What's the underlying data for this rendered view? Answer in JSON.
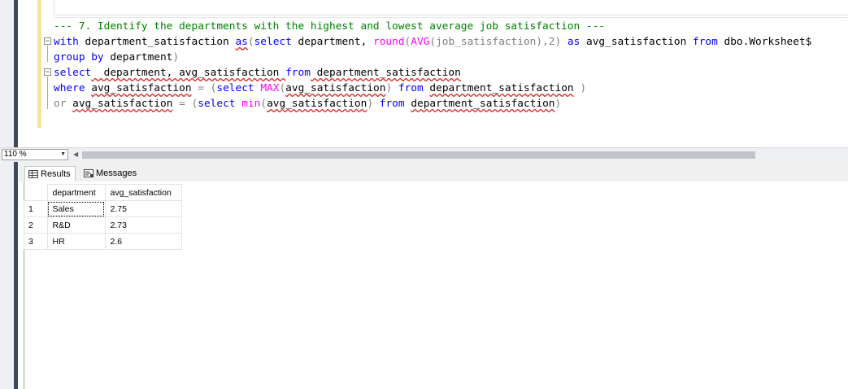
{
  "editor": {
    "comment": "--- 7. Identify the departments with the highest and lowest average job satisfaction ---",
    "line1": {
      "with": "with",
      "cte": " department_satisfaction ",
      "as": "as",
      "paren_open": "(",
      "select": "select",
      "department": " department, ",
      "round": "round",
      "p1": "(",
      "avg": "AVG",
      "p2": "(job_satisfaction),2) ",
      "as2": "as",
      "alias": " avg_satisfaction ",
      "from": "from",
      "table": " dbo.Worksheet$"
    },
    "line2": {
      "group_by": "group by",
      "department": " department",
      "close": ")"
    },
    "line3": {
      "select": "select",
      "cols": "  department, avg_satisfaction ",
      "from": "from",
      "cte": " department_satisfaction"
    },
    "line4": {
      "where": "where",
      "col": "avg_satisfaction",
      "eq": " = ",
      "p1": "(",
      "select": "select",
      "max": "MAX",
      "p2": "(",
      "arg": "avg_satisfaction",
      "p3": ") ",
      "from": "from",
      "cte": "department_satisfaction",
      "close": " )"
    },
    "line5": {
      "or": "or",
      "col": "avg_satisfaction",
      "eq": " = ",
      "p1": "(",
      "select": "select",
      "min": "min",
      "p2": "(",
      "arg": "avg_satisfaction",
      "p3": ") ",
      "from": "from",
      "cte": "department_satisfaction",
      "close": ")"
    }
  },
  "zoom": {
    "value": "110 %"
  },
  "tabs": {
    "results": "Results",
    "messages": "Messages"
  },
  "grid": {
    "columns": [
      "department",
      "avg_satisfaction"
    ],
    "rows": [
      {
        "num": "1",
        "department": "Sales",
        "avg_satisfaction": "2.75"
      },
      {
        "num": "2",
        "department": "R&D",
        "avg_satisfaction": "2.73"
      },
      {
        "num": "3",
        "department": "HR",
        "avg_satisfaction": "2.6"
      }
    ]
  },
  "icons": {
    "fold_collapse": "minus-box-icon",
    "zoom_dropdown": "chevron-down-icon",
    "scroll_left": "arrow-left-icon",
    "results_tab": "grid-icon",
    "messages_tab": "messages-icon"
  },
  "colors": {
    "keyword": "#0000ff",
    "function": "#ff00ff",
    "comment": "#008000",
    "operator": "#808080",
    "squiggle": "#e02020"
  }
}
